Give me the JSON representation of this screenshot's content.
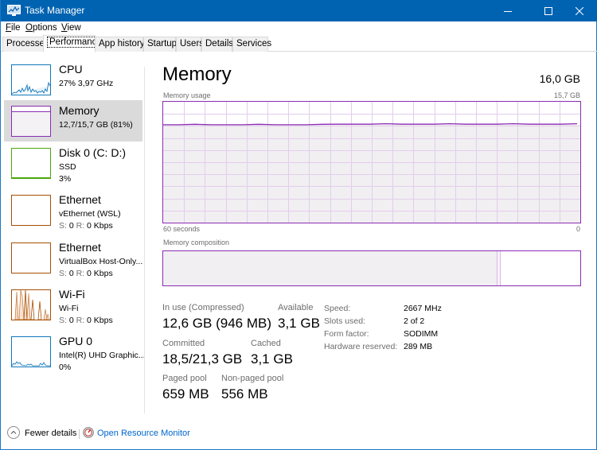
{
  "window": {
    "title": "Task Manager",
    "minimize_icon": "minimize-icon",
    "maximize_icon": "maximize-icon",
    "close_icon": "close-icon"
  },
  "menu": [
    {
      "label": "File",
      "accel": "F"
    },
    {
      "label": "Options",
      "accel": "O"
    },
    {
      "label": "View",
      "accel": "V"
    }
  ],
  "tabs": [
    {
      "label": "Processes",
      "active": false
    },
    {
      "label": "Performance",
      "active": true
    },
    {
      "label": "App history",
      "active": false
    },
    {
      "label": "Startup",
      "active": false
    },
    {
      "label": "Users",
      "active": false
    },
    {
      "label": "Details",
      "active": false
    },
    {
      "label": "Services",
      "active": false
    }
  ],
  "sidebar": {
    "items": [
      {
        "name": "CPU",
        "sub1": "27%  3,97 GHz",
        "sub2": "",
        "color": "#1177bb",
        "selected": false
      },
      {
        "name": "Memory",
        "sub1": "12,7/15,7 GB (81%)",
        "sub2": "",
        "color": "#8b2bb4",
        "selected": true
      },
      {
        "name": "Disk 0 (C: D:)",
        "sub1": "SSD",
        "sub2": "3%",
        "color": "#4da60c",
        "selected": false
      },
      {
        "name": "Ethernet",
        "sub1": "vEthernet (WSL)",
        "sub2_s_label": "S:",
        "sub2_s": "0",
        "sub2_r_label": "R:",
        "sub2_r": "0 Kbps",
        "color": "#a74f01",
        "selected": false
      },
      {
        "name": "Ethernet",
        "sub1": "VirtualBox Host-Only...",
        "sub2_s_label": "S:",
        "sub2_s": "0",
        "sub2_r_label": "R:",
        "sub2_r": "0 Kbps",
        "color": "#a74f01",
        "selected": false
      },
      {
        "name": "Wi-Fi",
        "sub1": "Wi-Fi",
        "sub2_s_label": "S:",
        "sub2_s": "0",
        "sub2_r_label": "R:",
        "sub2_r": "0 Kbps",
        "color": "#a74f01",
        "selected": false
      },
      {
        "name": "GPU 0",
        "sub1": "Intel(R) UHD Graphic...",
        "sub2": "0%",
        "color": "#1177bb",
        "selected": false
      }
    ]
  },
  "main": {
    "title": "Memory",
    "total": "16,0 GB",
    "usage_label": "Memory usage",
    "usage_max": "15,7 GB",
    "time_left": "60 seconds",
    "time_right": "0",
    "composition_label": "Memory composition",
    "accent": "#8b2bb4",
    "usage_fraction": 0.81,
    "composition": {
      "in_use_fraction": 0.8,
      "modified_fraction": 0.01,
      "standby_fraction": 0.0,
      "free_fraction": 0.19
    },
    "stats": {
      "in_use_label": "In use (Compressed)",
      "in_use_value": "12,6 GB (946 MB)",
      "available_label": "Available",
      "available_value": "3,1 GB",
      "committed_label": "Committed",
      "committed_value": "18,5/21,3 GB",
      "cached_label": "Cached",
      "cached_value": "3,1 GB",
      "paged_label": "Paged pool",
      "paged_value": "659 MB",
      "nonpaged_label": "Non-paged pool",
      "nonpaged_value": "556 MB"
    },
    "details": [
      {
        "label": "Speed:",
        "value": "2667 MHz"
      },
      {
        "label": "Slots used:",
        "value": "2 of 2"
      },
      {
        "label": "Form factor:",
        "value": "SODIMM"
      },
      {
        "label": "Hardware reserved:",
        "value": "289 MB"
      }
    ]
  },
  "footer": {
    "fewer_details": "Fewer details",
    "resource_monitor": "Open Resource Monitor"
  }
}
